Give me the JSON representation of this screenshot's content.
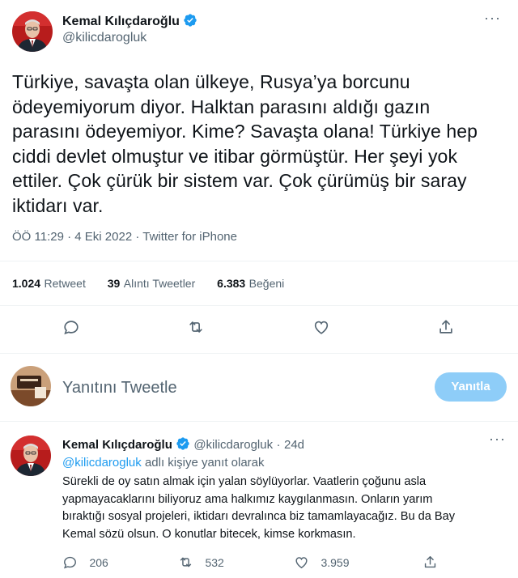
{
  "main_tweet": {
    "author_name": "Kemal Kılıçdaroğlu",
    "author_handle": "@kilicdarogluk",
    "text_lines": [
      "Türkiye, savaşta olan ülkeye, Rusya’ya borcunu",
      "ödeyemiyorum diyor. Halktan parasını aldığı gazın",
      "parasını ödeyemiyor. Kime? Savaşta olana! Türkiye hep",
      "ciddi devlet olmuştur ve itibar görmüştür. Her şeyi yok",
      "ettiler. Çok çürük bir sistem var. Çok çürümüş bir saray",
      "iktidarı var."
    ],
    "time": "ÖÖ 11:29",
    "date": "4 Eki 2022",
    "source": "Twitter for iPhone",
    "stats": {
      "retweets": "1.024",
      "retweets_label": "Retweet",
      "quotes": "39",
      "quotes_label": "Alıntı Tweetler",
      "likes": "6.383",
      "likes_label": "Beğeni"
    }
  },
  "reply_box": {
    "placeholder": "Yanıtını Tweetle",
    "button": "Yanıtla"
  },
  "reply_tweet": {
    "author_name": "Kemal Kılıçdaroğlu",
    "author_handle": "@kilicdarogluk",
    "age": "24d",
    "reply_to_handle": "@kilicdarogluk",
    "reply_to_suffix": "adlı kişiye yanıt olarak",
    "text_lines": [
      "Sürekli de oy satın almak için yalan söylüyorlar. Vaatlerin çoğunu asla",
      "yapmayacaklarını biliyoruz ama halkımız kaygılanmasın. Onların yarım",
      "bıraktığı sosyal projeleri, iktidarı devralınca biz tamamlayacağız. Bu da Bay",
      "Kemal sözü olsun. O konutlar bitecek, kimse korkmasın."
    ],
    "stats": {
      "replies": "206",
      "retweets": "532",
      "likes": "3.959"
    }
  },
  "colors": {
    "accent": "#1d9bf0",
    "button_disabled": "#8ecdf8",
    "secondary_text": "#536471"
  },
  "icons": [
    "verified-badge-icon",
    "more-options-icon",
    "reply-icon",
    "retweet-icon",
    "like-icon",
    "share-icon"
  ]
}
